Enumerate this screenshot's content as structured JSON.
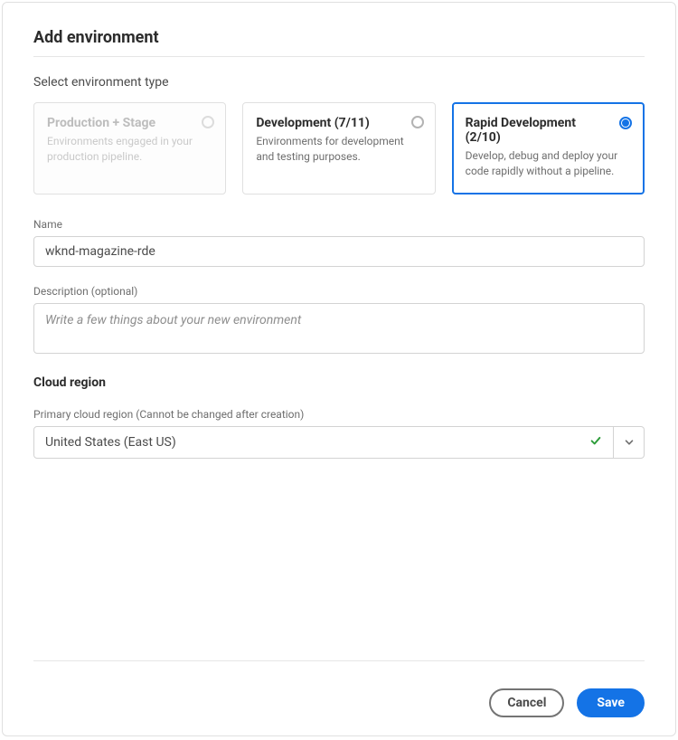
{
  "dialog_title": "Add environment",
  "section_label": "Select environment type",
  "env_types": [
    {
      "title": "Production + Stage",
      "desc": "Environments engaged in your production pipeline.",
      "disabled": true,
      "selected": false
    },
    {
      "title": "Development (7/11)",
      "desc": "Environments for development and testing purposes.",
      "disabled": false,
      "selected": false
    },
    {
      "title": "Rapid Development (2/10)",
      "desc": "Develop, debug and deploy your code rapidly without a pipeline.",
      "disabled": false,
      "selected": true
    }
  ],
  "name": {
    "label": "Name",
    "value": "wknd-magazine-rde"
  },
  "description": {
    "label": "Description (optional)",
    "placeholder": "Write a few things about your new environment"
  },
  "cloud_region": {
    "heading": "Cloud region",
    "primary_label": "Primary cloud region (Cannot be changed after creation)",
    "selected": "United States (East US)"
  },
  "buttons": {
    "cancel": "Cancel",
    "save": "Save"
  }
}
